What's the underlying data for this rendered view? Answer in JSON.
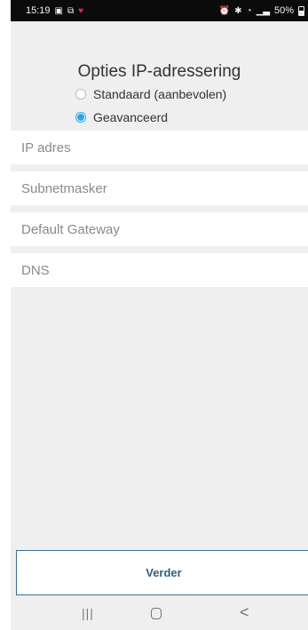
{
  "status_bar": {
    "time": "15:19",
    "left_icons": [
      "gallery-icon",
      "screenshot-icon",
      "heart-icon"
    ],
    "right_icons": [
      "alarm-icon",
      "bluetooth-icon",
      "wifi-icon",
      "signal-icon"
    ],
    "battery": "50%"
  },
  "form": {
    "title": "Opties IP-adressering",
    "radios": [
      {
        "label": "Standaard (aanbevolen)",
        "checked": false
      },
      {
        "label": "Geavanceerd",
        "checked": true
      }
    ],
    "fields": [
      {
        "placeholder": "IP adres",
        "value": ""
      },
      {
        "placeholder": "Subnetmasker",
        "value": ""
      },
      {
        "placeholder": "Default Gateway",
        "value": ""
      },
      {
        "placeholder": "DNS",
        "value": ""
      }
    ],
    "next_label": "Verder"
  },
  "nav_bar": {
    "recent_glyph": "|||",
    "back_glyph": "<"
  },
  "colors": {
    "accent": "#2aa7ea",
    "button_border": "#3b6e9b",
    "button_text": "#2f5f8a",
    "background": "#efefef"
  }
}
